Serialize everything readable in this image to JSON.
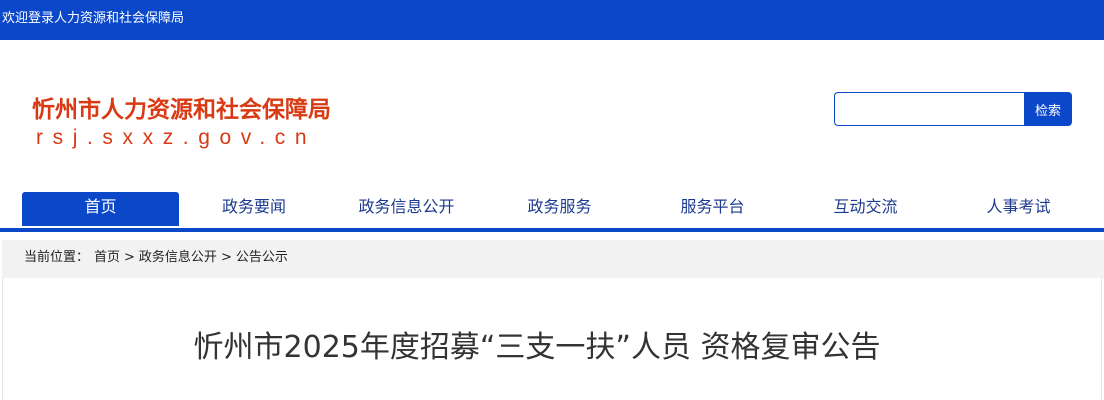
{
  "topbar": {
    "welcome": "欢迎登录人力资源和社会保障局"
  },
  "header": {
    "site_name": "忻州市人力资源和社会保障局",
    "domain": "rsj.sxxz.gov.cn"
  },
  "search": {
    "placeholder": "",
    "value": "",
    "button_label": "检索"
  },
  "nav": {
    "items": [
      {
        "label": "首页",
        "active": true
      },
      {
        "label": "政务要闻"
      },
      {
        "label": "政务信息公开"
      },
      {
        "label": "政务服务"
      },
      {
        "label": "服务平台"
      },
      {
        "label": "互动交流"
      },
      {
        "label": "人事考试"
      }
    ]
  },
  "breadcrumb": {
    "label": "当前位置：",
    "items": [
      "首页",
      "政务信息公开",
      "公告公示"
    ],
    "separator": ">"
  },
  "article": {
    "title": "忻州市2025年度招募“三支一扶”人员 资格复审公告"
  },
  "colors": {
    "brand_blue": "#0b47c9",
    "logo_red": "#d93a14",
    "breadcrumb_bg": "#f2f2f2"
  }
}
